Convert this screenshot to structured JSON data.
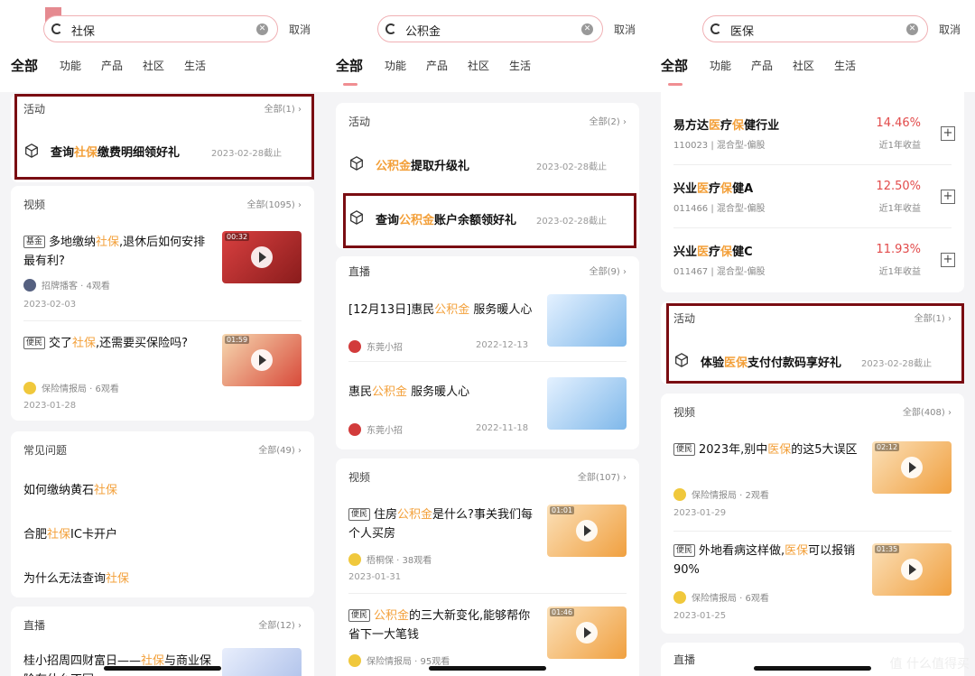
{
  "common": {
    "cancel": "取消",
    "tabs": [
      "全部",
      "功能",
      "产品",
      "社区",
      "生活"
    ],
    "accent": "#f3a03a",
    "highlight_box": "#7a0d12",
    "rate_color": "#e24b4b"
  },
  "panel1": {
    "query": "社保",
    "activity": {
      "header": "活动",
      "more": "全部(1)",
      "items": [
        {
          "pre": "查询",
          "hl": "社保",
          "post": "缴费明细领好礼",
          "date": "2023-02-28截止"
        }
      ]
    },
    "video": {
      "header": "视频",
      "more": "全部(1095)",
      "items": [
        {
          "tag": "基金",
          "pre": "多地缴纳",
          "hl": "社保",
          "post": ",退休后如何安排最有利?",
          "author": "招牌播客",
          "views": "4观看",
          "date": "2023-02-03",
          "duration": "00:32"
        },
        {
          "tag": "便民",
          "pre": "交了",
          "hl": "社保",
          "post": ",还需要买保险吗?",
          "author": "保险情报局",
          "views": "6观看",
          "date": "2023-01-28",
          "duration": "01:59"
        }
      ]
    },
    "faq": {
      "header": "常见问题",
      "more": "全部(49)",
      "items": [
        {
          "pre": "如何缴纳黄石",
          "hl": "社保",
          "post": ""
        },
        {
          "pre": "合肥",
          "hl": "社保",
          "post": "IC卡开户"
        },
        {
          "pre": "为什么无法查询",
          "hl": "社保",
          "post": ""
        }
      ]
    },
    "live": {
      "header": "直播",
      "more": "全部(12)",
      "title_pre": "桂小招周四财富日——",
      "title_hl": "社保",
      "title_post": "与商业保险有什么不同"
    }
  },
  "panel2": {
    "query": "公积金",
    "activity": {
      "header": "活动",
      "more": "全部(2)",
      "items": [
        {
          "pre": "",
          "hl": "公积金",
          "post": "提取升级礼",
          "date": "2023-02-28截止"
        },
        {
          "pre": "查询",
          "hl": "公积金",
          "post": "账户余额领好礼",
          "date": "2023-02-28截止"
        }
      ]
    },
    "live": {
      "header": "直播",
      "more": "全部(9)",
      "items": [
        {
          "pre": "[12月13日]惠民",
          "hl": "公积金",
          "post": " 服务暖人心",
          "author": "东莞小招",
          "date": "2022-12-13"
        },
        {
          "pre": "惠民",
          "hl": "公积金",
          "post": " 服务暖人心",
          "author": "东莞小招",
          "date": "2022-11-18"
        }
      ]
    },
    "video": {
      "header": "视频",
      "more": "全部(107)",
      "items": [
        {
          "tag": "便民",
          "pre": "住房",
          "hl": "公积金",
          "post": "是什么?事关我们每个人买房",
          "author": "梧桐保",
          "views": "38观看",
          "date": "2023-01-31",
          "duration": "01:01"
        },
        {
          "tag": "便民",
          "pre": "",
          "hl": "公积金",
          "post": "的三大新变化,能够帮你省下一大笔钱",
          "author": "保险情报局",
          "views": "95观看",
          "date": "",
          "duration": "01:46"
        }
      ]
    }
  },
  "panel3": {
    "query": "医保",
    "funds": [
      {
        "pre": "易方达",
        "hl1": "医",
        "mid": "疗",
        "hl2": "保",
        "post": "健行业",
        "code": "110023",
        "type": "混合型-偏股",
        "rate": "14.46%",
        "label": "近1年收益"
      },
      {
        "pre": "兴业",
        "hl1": "医",
        "mid": "疗",
        "hl2": "保",
        "post": "健A",
        "code": "011466",
        "type": "混合型-偏股",
        "rate": "12.50%",
        "label": "近1年收益"
      },
      {
        "pre": "兴业",
        "hl1": "医",
        "mid": "疗",
        "hl2": "保",
        "post": "健C",
        "code": "011467",
        "type": "混合型-偏股",
        "rate": "11.93%",
        "label": "近1年收益"
      }
    ],
    "activity": {
      "header": "活动",
      "more": "全部(1)",
      "items": [
        {
          "pre": "体验",
          "hl": "医保",
          "post": "支付付款码享好礼",
          "date": "2023-02-28截止"
        }
      ]
    },
    "video": {
      "header": "视频",
      "more": "全部(408)",
      "items": [
        {
          "tag": "便民",
          "pre": "2023年,别中",
          "hl": "医保",
          "post": "的这5大误区",
          "author": "保险情报局",
          "views": "2观看",
          "date": "2023-01-29",
          "duration": "02:12"
        },
        {
          "tag": "便民",
          "pre": "外地看病这样做,",
          "hl": "医保",
          "post": "可以报销90%",
          "author": "保险情报局",
          "views": "6观看",
          "date": "2023-01-25",
          "duration": "01:35"
        }
      ]
    },
    "live_header": "直播",
    "watermark": "值 什么值得买"
  }
}
